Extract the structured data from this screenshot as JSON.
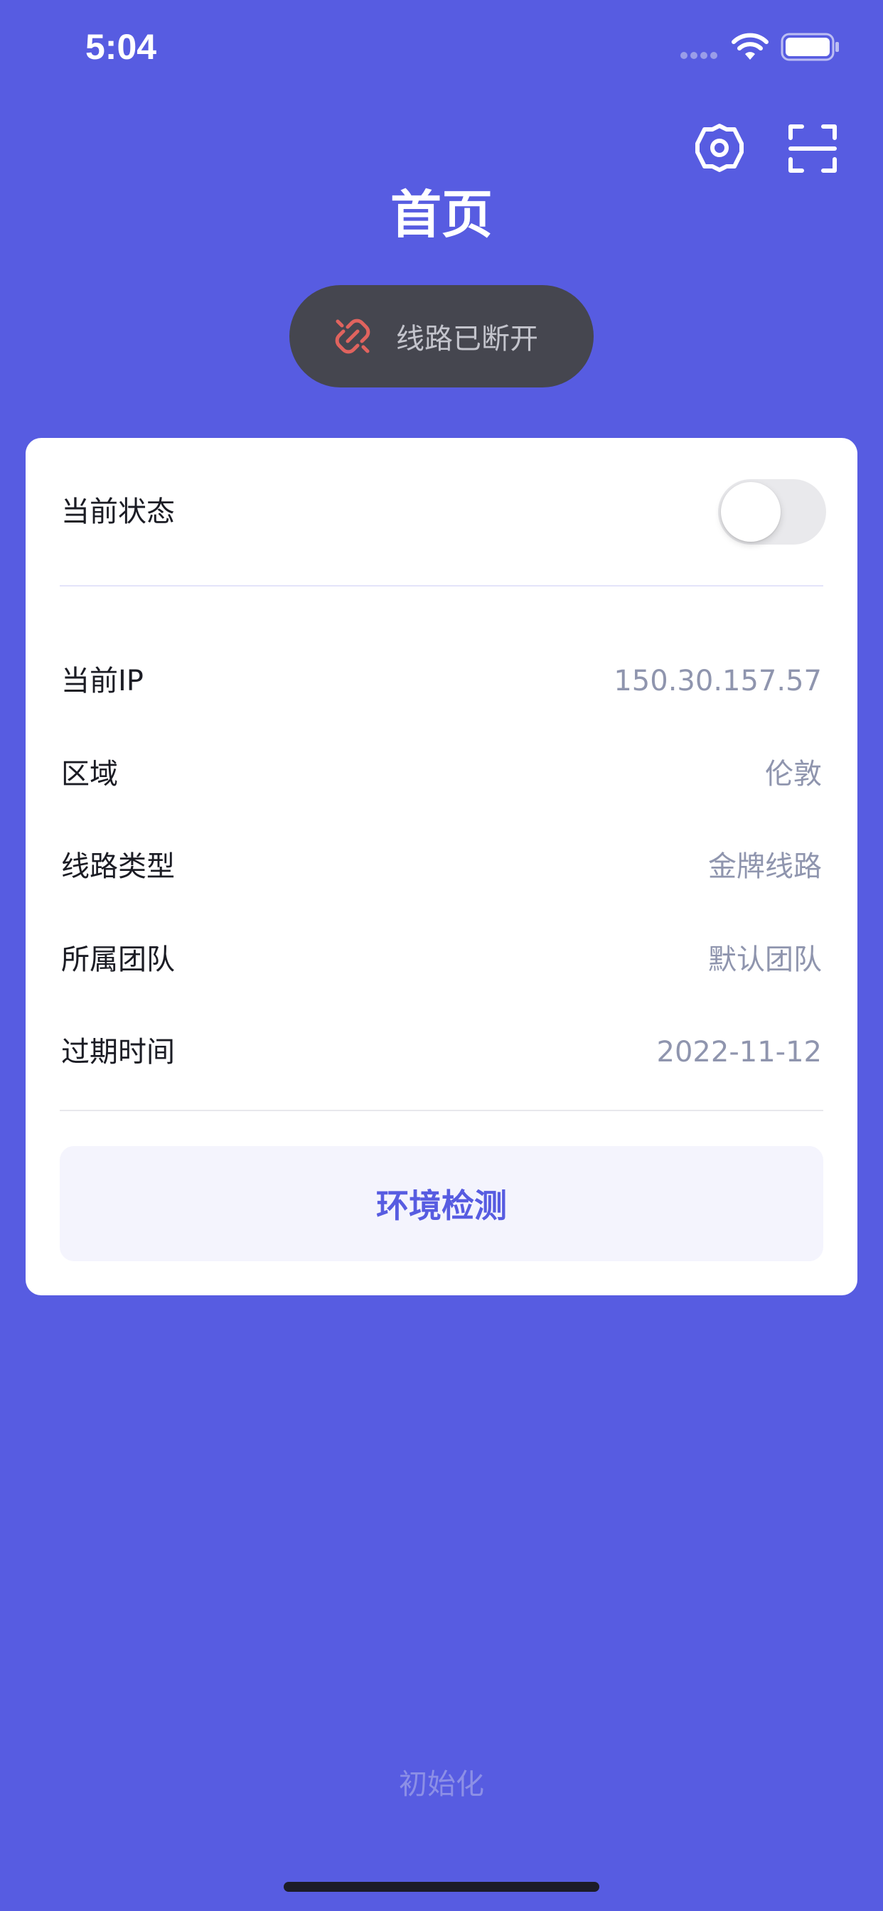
{
  "status_bar": {
    "time": "5:04"
  },
  "header": {
    "title": "首页",
    "settings_icon": "gear-icon",
    "scan_icon": "scan-frame-icon"
  },
  "connection": {
    "status_text": "线路已断开",
    "icon": "broken-link-icon",
    "icon_color": "#e0635e"
  },
  "card": {
    "status_label": "当前状态",
    "toggle_on": false,
    "rows": [
      {
        "label": "当前IP",
        "value": "150.30.157.57"
      },
      {
        "label": "区域",
        "value": "伦敦"
      },
      {
        "label": "线路类型",
        "value": "金牌线路"
      },
      {
        "label": "所属团队",
        "value": "默认团队"
      },
      {
        "label": "过期时间",
        "value": "2022-11-12"
      }
    ],
    "env_button_label": "环境检测"
  },
  "footer": {
    "init_label": "初始化"
  },
  "colors": {
    "background": "#575ce1",
    "accent": "#575ce1",
    "value_text": "#8f95ae",
    "pill_background": "#45464f"
  }
}
